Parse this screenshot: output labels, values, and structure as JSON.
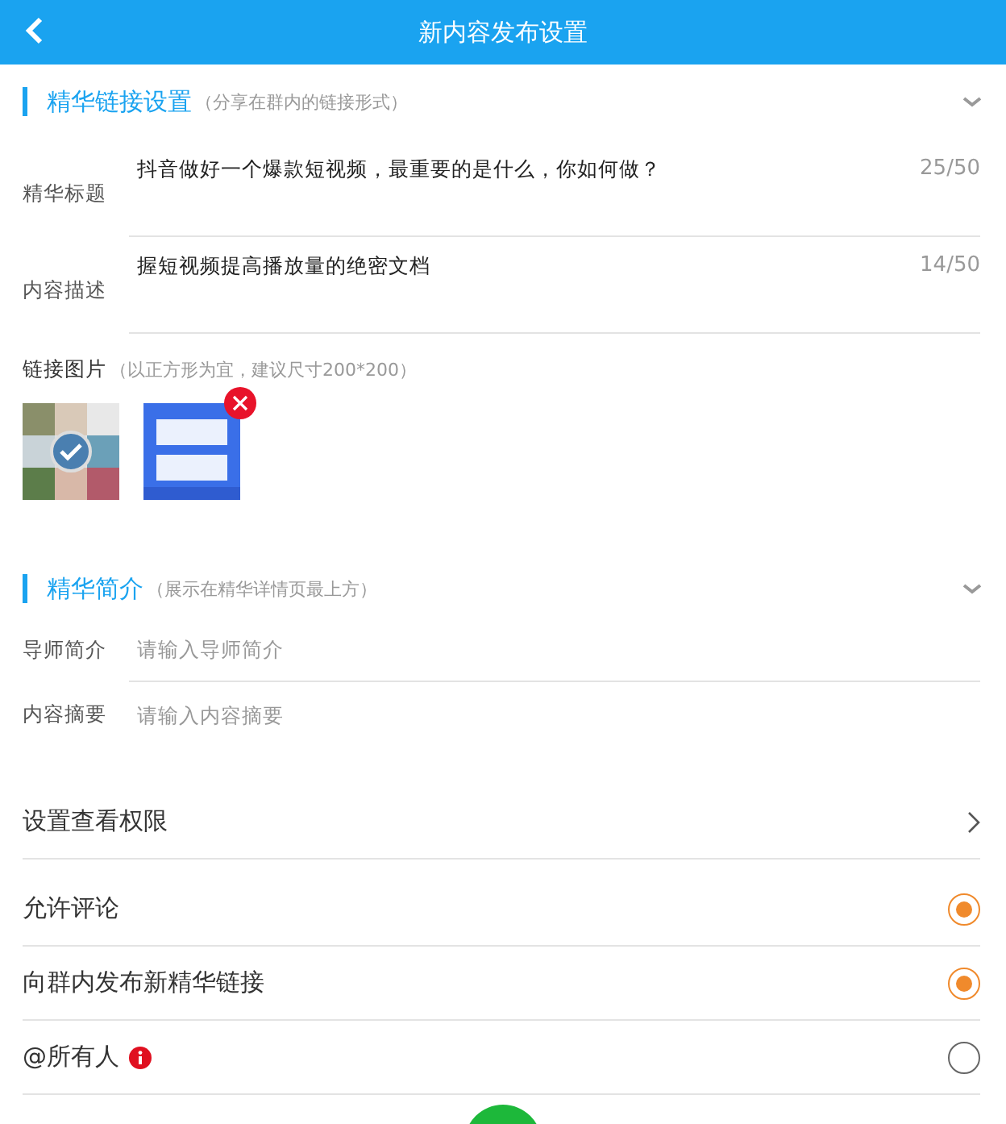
{
  "header": {
    "title": "新内容发布设置"
  },
  "link_section": {
    "title": "精华链接设置",
    "hint": "（分享在群内的链接形式）",
    "expanded": true,
    "fields": [
      {
        "label": "精华标题",
        "value": "抖音做好一个爆款短视频，最重要的是什么，你如何做？",
        "count": "25/50"
      },
      {
        "label": "内容描述",
        "value": "握短视频提高播放量的绝密文档",
        "count": "14/50"
      }
    ],
    "image_label": "链接图片",
    "image_hint": "（以正方形为宜，建议尺寸200*200）",
    "images": [
      {
        "kind": "grid",
        "selected": true,
        "removable": false
      },
      {
        "kind": "poster",
        "selected": false,
        "removable": true
      }
    ]
  },
  "intro_section": {
    "title": "精华简介",
    "hint": "（展示在精华详情页最上方）",
    "expanded": true,
    "fields": [
      {
        "label": "导师简介",
        "placeholder": "请输入导师简介"
      },
      {
        "label": "内容摘要",
        "placeholder": "请输入内容摘要"
      }
    ]
  },
  "permission": {
    "label": "设置查看权限"
  },
  "toggles": [
    {
      "label": "允许评论",
      "on": true,
      "info": false
    },
    {
      "label": "向群内发布新精华链接",
      "on": true,
      "info": false
    },
    {
      "label": "@所有人",
      "on": false,
      "info": true
    }
  ]
}
